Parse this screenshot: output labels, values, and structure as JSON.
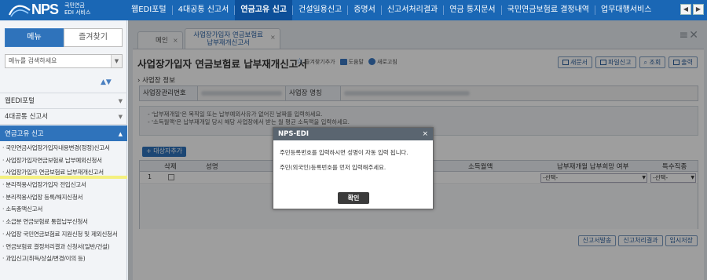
{
  "brand": {
    "logo_text": "NPS",
    "sub_line1": "국민연금",
    "sub_line2": "EDI 서비스"
  },
  "top_nav": {
    "items": [
      {
        "label": "웹EDI포털"
      },
      {
        "label": "4대공통 신고서"
      },
      {
        "label": "연금고유 신고",
        "active": true
      },
      {
        "label": "건설일용신고"
      },
      {
        "label": "증명서"
      },
      {
        "label": "신고서처리결과"
      },
      {
        "label": "연금 통지문서"
      },
      {
        "label": "국민연금보험료 결정내역"
      },
      {
        "label": "업무대행서비스"
      }
    ]
  },
  "sidebar": {
    "tab_menu": "메뉴",
    "tab_favorites": "즐겨찾기",
    "search_placeholder": "메뉴를 검색하세요",
    "sections": [
      {
        "label": "웹EDI포털"
      },
      {
        "label": "4대공통 신고서"
      },
      {
        "label": "연금고유 신고",
        "active": true
      }
    ],
    "links": [
      "· 국민연금사업장가입자내용변경(정정)신고서",
      "· 사업장가입자연금보험료 납부예외신청서",
      "· 사업장가입자 연금보험료 납부재개신고서",
      "· 분리적용사업장가입자 전입신고서",
      "· 분리적용사업장 등록/해지신청서",
      "· 소득총액신고서",
      "· 소급분 연금보험료 통합납부신청서",
      "· 사업장 국민연금보험료 지원신청 및 제외신청서",
      "· 연금보험료 결정처리결과 신청서(일반/건설)",
      "· 과입신고(취득/상실/변경/이의 등)"
    ]
  },
  "tabs": [
    {
      "label": "메인"
    },
    {
      "label_line1": "사업장가입자 연금보험료",
      "label_line2": "납부재개신고서",
      "active": true
    }
  ],
  "page": {
    "title": "사업장가입자 연금보험료 납부재개신고서",
    "action_favorite": "즐겨찾기추가",
    "action_help": "도움말",
    "action_refresh": "새로고침",
    "btn_new": "새문서",
    "btn_file": "파일신고",
    "btn_search": "조회",
    "btn_print": "출력",
    "section_label": "› 사업장 정보",
    "field_reg_no": "사업장관리번호",
    "field_name": "사업장 명칭",
    "notice_line1": "- '납부재개일'은 복직일 또는 납부예외사유가 없어진 날짜를 입력하세요.",
    "notice_line2": "- '소득월액'은 납부재개일 당시 해당 사업장에서 받는 월 평균 소득액을 입력하세요.",
    "btn_add": "+ 대상자추가",
    "grid_headers": {
      "delete": "삭제",
      "name": "성명",
      "income": "소득월액",
      "wish": "납부재개월 납부희망 여부",
      "special": "특수직종"
    },
    "grid_row_num": "1",
    "select_default": "-선택-",
    "btn_report": "신고서발송",
    "btn_result": "신고처리결과",
    "btn_save": "임시저장"
  },
  "modal": {
    "title": "NPS-EDI",
    "close": "×",
    "message1": "주민등록번호를 입력하시면 성명이 자동 입력 됩니다.",
    "message2": "주민(외국인)등록번호를 먼저 입력해주세요.",
    "ok": "확인"
  },
  "colors": {
    "topbar": "#1a67b5",
    "active_nav": "#0d4f99",
    "accent": "#2f73bb",
    "modal_header": "#5a6570"
  }
}
